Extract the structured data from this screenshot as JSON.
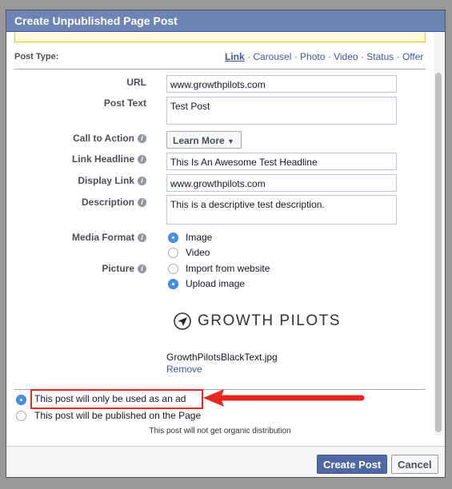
{
  "dialog": {
    "title": "Create Unpublished Page Post"
  },
  "post_type": {
    "label": "Post Type:",
    "options": [
      "Link",
      "Carousel",
      "Photo",
      "Video",
      "Status",
      "Offer"
    ],
    "selected": "Link"
  },
  "form": {
    "url": {
      "label": "URL",
      "value": "www.growthpilots.com"
    },
    "post_text": {
      "label": "Post Text",
      "value": "Test Post"
    },
    "cta": {
      "label": "Call to Action",
      "value": "Learn More"
    },
    "headline": {
      "label": "Link Headline",
      "value": "This Is An Awesome Test Headline"
    },
    "display_link": {
      "label": "Display Link",
      "value": "www.growthpilots.com"
    },
    "description": {
      "label": "Description",
      "value": "This is a descriptive test description."
    },
    "media_format": {
      "label": "Media Format",
      "options": [
        "Image",
        "Video"
      ],
      "selected": "Image"
    },
    "picture": {
      "label": "Picture",
      "options": [
        "Import from website",
        "Upload image"
      ],
      "selected": "Upload image"
    },
    "image": {
      "logo_text": "GROWTH PILOTS",
      "filename": "GrowthPilotsBlackText.jpg",
      "remove": "Remove"
    }
  },
  "distribution": {
    "options": [
      "This post will only be used as an ad",
      "This post will be published on the Page"
    ],
    "selected": 0,
    "note": "This post will not get organic distribution"
  },
  "footer": {
    "create": "Create Post",
    "cancel": "Cancel"
  },
  "colors": {
    "header": "#6d84b4",
    "annotation": "#e8281e",
    "radio": "#4a90e2"
  }
}
